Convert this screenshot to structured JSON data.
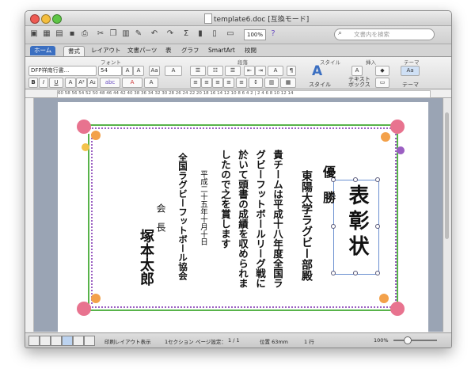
{
  "window": {
    "title": "template6.doc [互換モード]"
  },
  "toolbar": {
    "zoom": "100%",
    "search_placeholder": "文書内を検索"
  },
  "tabs": [
    "ホーム",
    "書式",
    "レイアウト",
    "文書パーツ",
    "表",
    "グラフ",
    "SmartArt",
    "校閲"
  ],
  "ribbon": {
    "font_group": "フォント",
    "paragraph_group": "段落",
    "style_group": "スタイル",
    "insert_group": "挿入",
    "theme_group": "テーマ",
    "font_name": "DFP祥南行書...",
    "font_size": "54",
    "style_button": "スタイル",
    "textbox_button": "テキスト ボックス",
    "theme_button": "テーマ"
  },
  "ruler": {
    "numbers": "60 58 56 54 52 50 48 46 44 42 40 38 36 34 32 30 28 26 24 22 20 18 16 14 12 10 8 6 4 2 | 2 4 6 8 10 12 14"
  },
  "document": {
    "award": "優　勝",
    "recipient": "東陽大学ラグビー部殿",
    "title": "表彰状",
    "body_lines": [
      "貴チームは平成十八年度全国ラ",
      "グビーフットボールリーグ戦に",
      "於いて頭書の成績を収められま",
      "したので之を賞します"
    ],
    "date": "平成二十五年十月十日",
    "organization": "全国ラグビーフットボール協会",
    "signer_title": "会　長",
    "signer_name": "塚本太郎"
  },
  "status": {
    "view_mode": "印刷レイアウト表示",
    "section": "1セクション",
    "page_label": "ページ設定：",
    "page_count": "1 / 1",
    "position": "位置 63mm",
    "line": "1 行",
    "zoom": "100%"
  },
  "colors": {
    "border_green": "#58b34a",
    "border_purple": "#9b5fc2",
    "rose": "#e8738f",
    "orange": "#f3a14a",
    "accent_blue": "#3b6fc1"
  }
}
